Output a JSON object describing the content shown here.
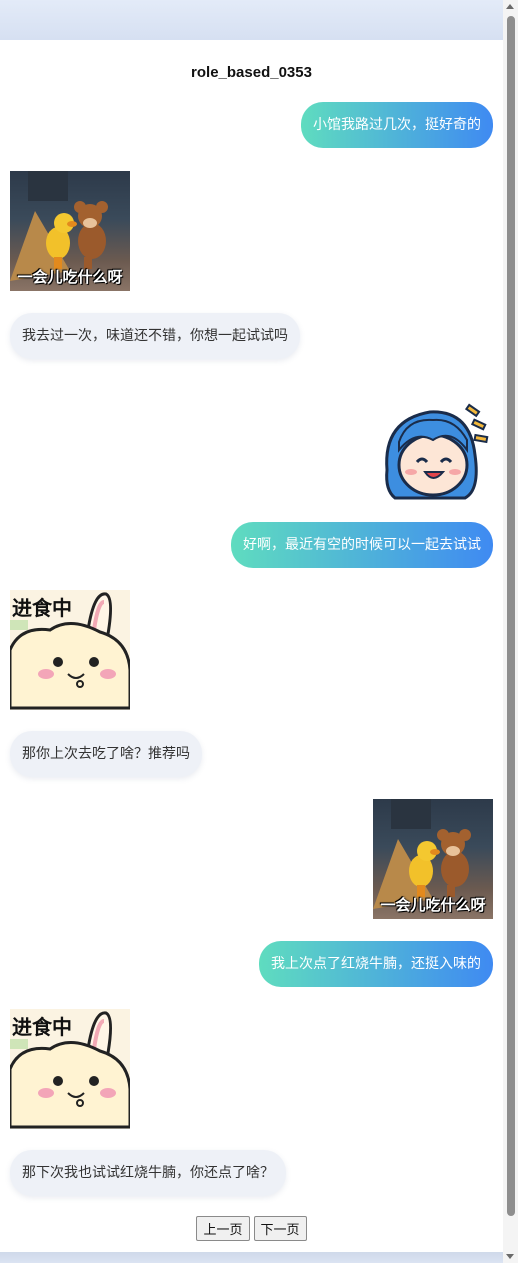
{
  "title": "role_based_0353",
  "messages": [
    {
      "side": "right",
      "type": "text",
      "text": "小馆我路过几次，挺好奇的"
    },
    {
      "side": "left",
      "type": "sticker",
      "sticker": "tom-jerry-sticker",
      "caption": "一会儿吃什么呀"
    },
    {
      "side": "left",
      "type": "text",
      "text": "我去过一次，味道还不错，你想一起试试吗"
    },
    {
      "side": "right",
      "type": "sticker",
      "sticker": "happy-blue-hair-girl-sticker",
      "caption": ""
    },
    {
      "side": "right",
      "type": "text",
      "text": "好啊，最近有空的时候可以一起去试试"
    },
    {
      "side": "left",
      "type": "sticker",
      "sticker": "eating-bunny-sticker",
      "caption": "进食中"
    },
    {
      "side": "left",
      "type": "text",
      "text": "那你上次去吃了啥？推荐吗"
    },
    {
      "side": "right",
      "type": "sticker",
      "sticker": "tom-jerry-sticker",
      "caption": "一会儿吃什么呀"
    },
    {
      "side": "right",
      "type": "text",
      "text": "我上次点了红烧牛腩，还挺入味的"
    },
    {
      "side": "left",
      "type": "sticker",
      "sticker": "eating-bunny-sticker",
      "caption": "进食中"
    },
    {
      "side": "left",
      "type": "text",
      "text": "那下次我也试试红烧牛腩，你还点了啥？"
    }
  ],
  "pager": {
    "prev_label": "上一页",
    "next_label": "下一页"
  },
  "colors": {
    "accent_start": "#5fdcbf",
    "accent_end": "#3f8af2",
    "incoming_bubble": "#eef1f7"
  }
}
